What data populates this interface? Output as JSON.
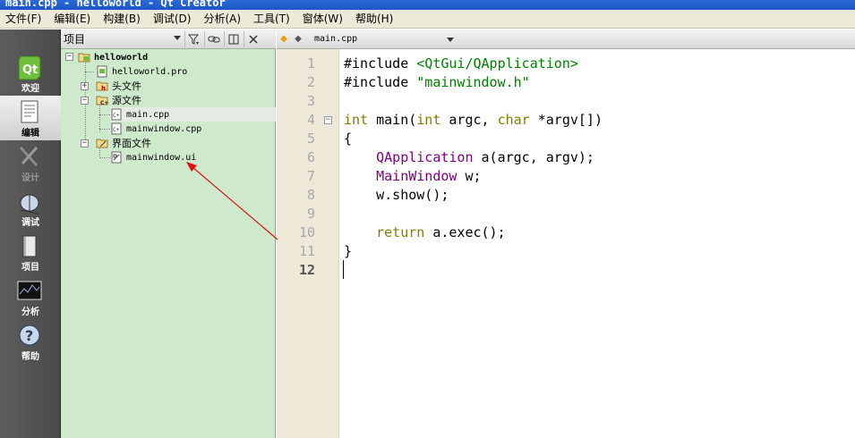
{
  "window": {
    "title": "main.cpp - helloworld - Qt Creator"
  },
  "menu": [
    "文件(F)",
    "编辑(E)",
    "构建(B)",
    "调试(D)",
    "分析(A)",
    "工具(T)",
    "窗体(W)",
    "帮助(H)"
  ],
  "modes": [
    {
      "label": "欢迎",
      "icon": "qt-logo-icon",
      "state": "normal"
    },
    {
      "label": "编辑",
      "icon": "edit-document-icon",
      "state": "active"
    },
    {
      "label": "设计",
      "icon": "design-tools-icon",
      "state": "disabled"
    },
    {
      "label": "调试",
      "icon": "debug-bug-icon",
      "state": "normal"
    },
    {
      "label": "项目",
      "icon": "project-book-icon",
      "state": "normal"
    },
    {
      "label": "分析",
      "icon": "analyze-monitor-icon",
      "state": "normal"
    },
    {
      "label": "帮助",
      "icon": "help-question-icon",
      "state": "normal"
    }
  ],
  "project_panel": {
    "title": "项目",
    "buttons": [
      "filter-icon",
      "link-icon",
      "split-icon",
      "close-icon"
    ],
    "tree": [
      {
        "label": "helloworld",
        "icon": "qt-project-folder-icon"
      },
      {
        "label": "helloworld.pro",
        "icon": "pro-file-icon"
      },
      {
        "label": "头文件",
        "icon": "header-folder-icon"
      },
      {
        "label": "源文件",
        "icon": "source-folder-icon"
      },
      {
        "label": "main.cpp",
        "icon": "cpp-file-icon"
      },
      {
        "label": "mainwindow.cpp",
        "icon": "cpp-file-icon"
      },
      {
        "label": "界面文件",
        "icon": "forms-folder-icon"
      },
      {
        "label": "mainwindow.ui",
        "icon": "ui-file-icon"
      }
    ]
  },
  "editor": {
    "current_file": "main.cpp",
    "current_line": "12",
    "line_numbers": [
      "1",
      "2",
      "3",
      "4",
      "5",
      "6",
      "7",
      "8",
      "9",
      "10",
      "11",
      "12"
    ],
    "lines": [
      [
        {
          "t": "#include ",
          "c": "plain"
        },
        {
          "t": "<QtGui/QApplication>",
          "c": "str"
        }
      ],
      [
        {
          "t": "#include ",
          "c": "plain"
        },
        {
          "t": "\"mainwindow.h\"",
          "c": "str"
        }
      ],
      [],
      [
        {
          "t": "int",
          "c": "kw"
        },
        {
          "t": " main(",
          "c": "plain"
        },
        {
          "t": "int",
          "c": "kw"
        },
        {
          "t": " argc, ",
          "c": "plain"
        },
        {
          "t": "char",
          "c": "kw"
        },
        {
          "t": " *argv[])",
          "c": "plain"
        }
      ],
      [
        {
          "t": "{",
          "c": "plain"
        }
      ],
      [
        {
          "t": "    ",
          "c": "plain"
        },
        {
          "t": "QApplication",
          "c": "type"
        },
        {
          "t": " a(argc, argv);",
          "c": "plain"
        }
      ],
      [
        {
          "t": "    ",
          "c": "plain"
        },
        {
          "t": "MainWindow",
          "c": "type"
        },
        {
          "t": " w;",
          "c": "plain"
        }
      ],
      [
        {
          "t": "    w.show();",
          "c": "plain"
        }
      ],
      [],
      [
        {
          "t": "    ",
          "c": "plain"
        },
        {
          "t": "return",
          "c": "kw"
        },
        {
          "t": " a.exec();",
          "c": "plain"
        }
      ],
      [
        {
          "t": "}",
          "c": "plain"
        }
      ],
      []
    ]
  },
  "colors": {
    "keyword": "#808000",
    "string": "#008000",
    "type": "#800080",
    "annotation": "#dd1111",
    "tree_bg": "#cfe9cd"
  }
}
